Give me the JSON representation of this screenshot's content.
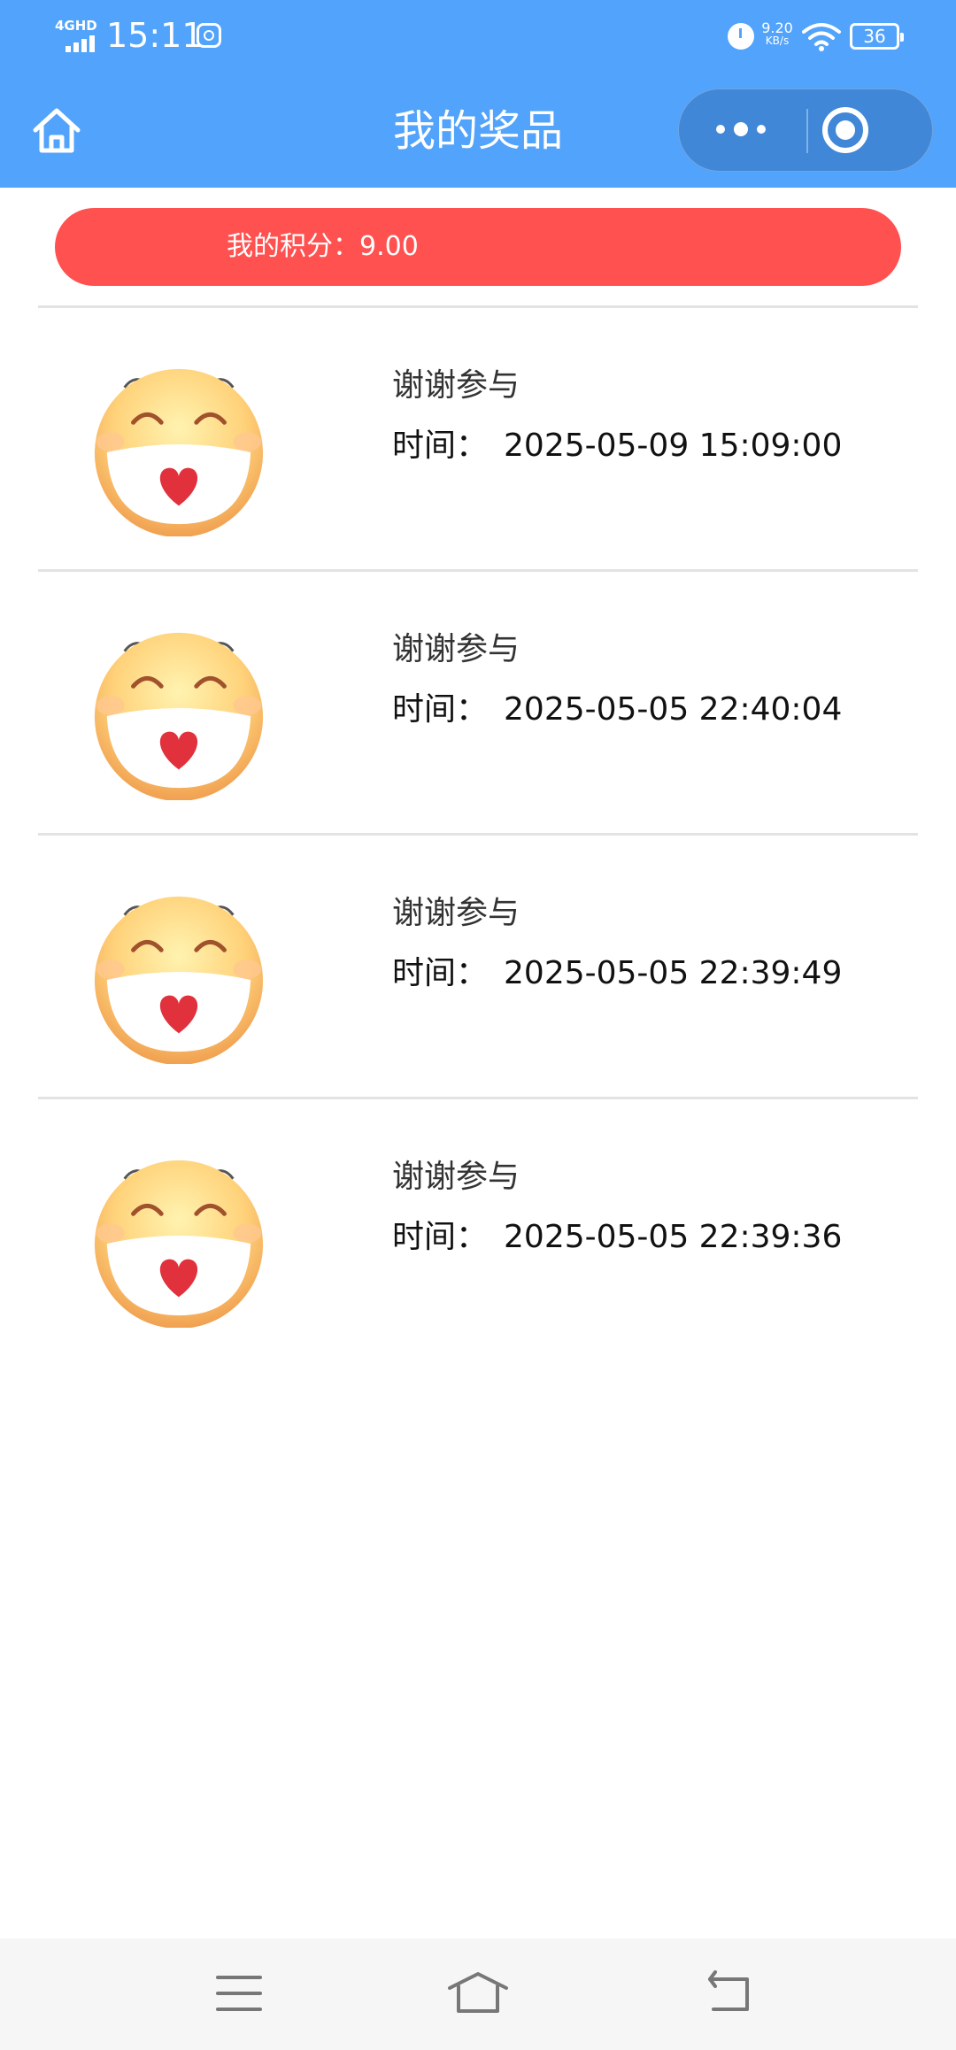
{
  "status_bar": {
    "network": "4GHD",
    "time": "15:11",
    "speed_value": "9.20",
    "speed_unit": "KB/s",
    "battery": "36"
  },
  "nav": {
    "title": "我的奖品",
    "icons": {
      "home": "home-icon",
      "more": "more-dots-icon",
      "close": "target-close-icon"
    }
  },
  "points": {
    "text": "我的积分：9.00"
  },
  "prizes": [
    {
      "name": "谢谢参与",
      "time_label": "时间：",
      "time": "2025-05-09 15:09:00"
    },
    {
      "name": "谢谢参与",
      "time_label": "时间：",
      "time": "2025-05-05 22:40:04"
    },
    {
      "name": "谢谢参与",
      "time_label": "时间：",
      "time": "2025-05-05 22:39:49"
    },
    {
      "name": "谢谢参与",
      "time_label": "时间：",
      "time": "2025-05-05 22:39:36"
    }
  ],
  "system_nav": {
    "icons": [
      "menu-icon",
      "home-icon",
      "back-icon"
    ]
  },
  "colors": {
    "header": "#52a3fb",
    "banner": "#ff5150",
    "capsule": "#4087d7",
    "divider": "#e3e3e3"
  }
}
